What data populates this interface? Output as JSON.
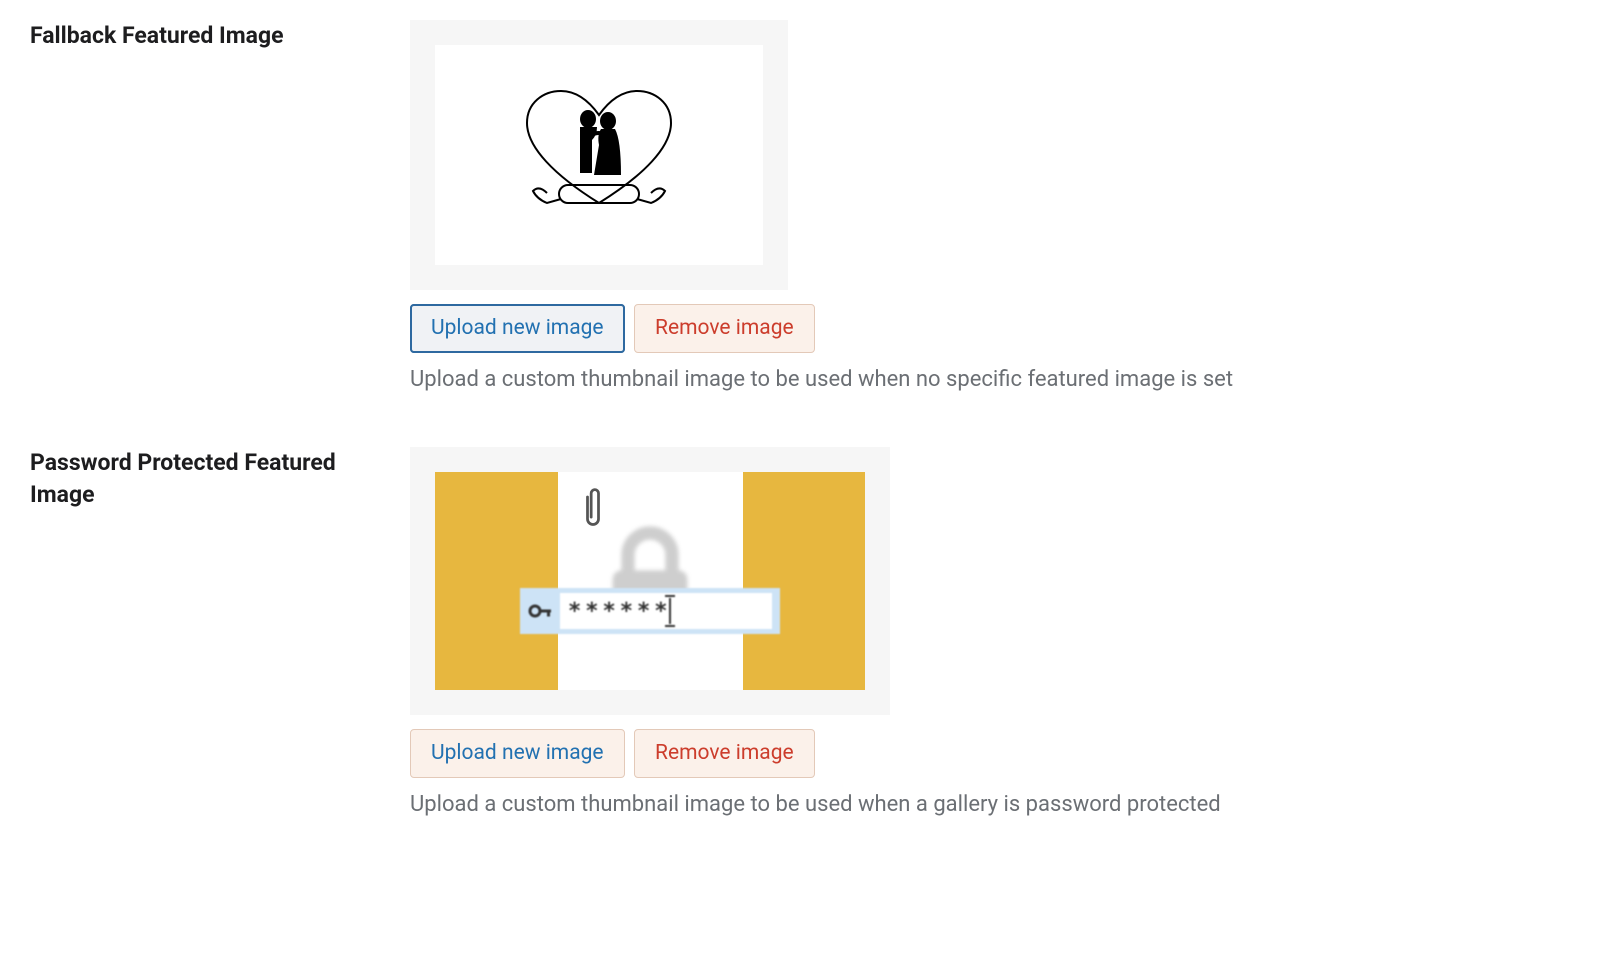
{
  "fallback": {
    "label": "Fallback Featured Image",
    "upload_btn": "Upload new image",
    "remove_btn": "Remove image",
    "help": "Upload a custom thumbnail image to be used when no specific featured image is set"
  },
  "protected": {
    "label": "Password Protected Featured Image",
    "upload_btn": "Upload new image",
    "remove_btn": "Remove image",
    "help": "Upload a custom thumbnail image to be used when a gallery is password protected",
    "password_mask": "******"
  }
}
